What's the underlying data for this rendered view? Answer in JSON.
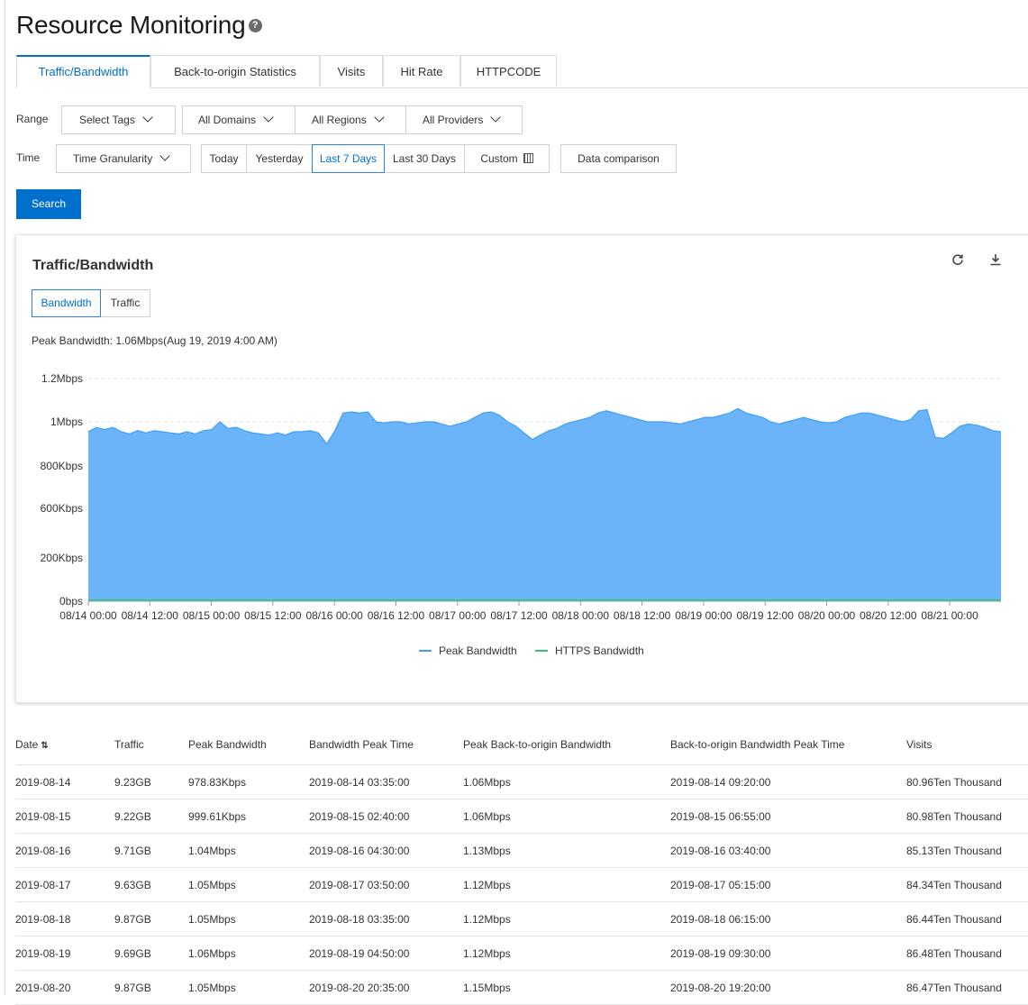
{
  "page": {
    "title": "Resource Monitoring",
    "help_icon": "question-circle-icon"
  },
  "tabs": [
    {
      "label": "Traffic/Bandwidth",
      "active": true
    },
    {
      "label": "Back-to-origin Statistics"
    },
    {
      "label": "Visits"
    },
    {
      "label": "Hit Rate"
    },
    {
      "label": "HTTPCODE"
    }
  ],
  "filters": {
    "range_label": "Range",
    "range_dropdowns": [
      "Select Tags",
      "All Domains",
      "All Regions",
      "All Providers"
    ],
    "time_label": "Time",
    "granularity": "Time Granularity",
    "time_options": [
      "Today",
      "Yesterday",
      "Last 7 Days",
      "Last 30 Days"
    ],
    "selected_time": "Last 7 Days",
    "custom": "Custom",
    "data_comparison": "Data comparison",
    "search": "Search"
  },
  "chart_card": {
    "title": "Traffic/Bandwidth",
    "tools": [
      "refresh-icon",
      "download-icon",
      "collapse-icon"
    ],
    "mini_tabs": [
      "Bandwidth",
      "Traffic"
    ],
    "active_mini_tab": "Bandwidth",
    "peak_text": "Peak Bandwidth: 1.06Mbps(Aug 19, 2019 4:00 AM)"
  },
  "chart_data": {
    "type": "area",
    "y_ticks": [
      "0bps",
      "200Kbps",
      "600Kbps",
      "800Kbps",
      "1Mbps",
      "1.2Mbps"
    ],
    "x_ticks": [
      "08/14 00:00",
      "08/14 12:00",
      "08/15 00:00",
      "08/15 12:00",
      "08/16 00:00",
      "08/16 12:00",
      "08/17 00:00",
      "08/17 12:00",
      "08/18 00:00",
      "08/18 12:00",
      "08/19 00:00",
      "08/19 12:00",
      "08/20 00:00",
      "08/20 12:00",
      "08/21 00:00"
    ],
    "x_hours_range": [
      0,
      178
    ],
    "grid": "horizontal-dashed",
    "legend_position": "bottom-center",
    "series": [
      {
        "name": "Peak Bandwidth",
        "color": "#3d9ff5",
        "fill": "#6cb4fa",
        "unit": "Kbps",
        "values": [
          955,
          975,
          965,
          975,
          955,
          945,
          960,
          950,
          960,
          955,
          950,
          945,
          955,
          945,
          960,
          965,
          1000,
          970,
          975,
          960,
          950,
          945,
          940,
          950,
          940,
          955,
          955,
          960,
          950,
          900,
          960,
          1040,
          1045,
          1040,
          1045,
          1000,
          995,
          1000,
          1000,
          990,
          995,
          1000,
          1000,
          990,
          980,
          990,
          1000,
          1020,
          1040,
          1045,
          1030,
          1000,
          980,
          950,
          920,
          940,
          960,
          970,
          990,
          1000,
          1010,
          1020,
          1040,
          1050,
          1040,
          1030,
          1020,
          1010,
          1000,
          1000,
          1000,
          995,
          990,
          1000,
          1010,
          1020,
          1020,
          1030,
          1040,
          1060,
          1040,
          1030,
          1020,
          1000,
          990,
          1000,
          1010,
          1020,
          1010,
          1000,
          995,
          1000,
          1020,
          1030,
          1040,
          1040,
          1030,
          1020,
          1010,
          1000,
          1010,
          1050,
          1055,
          930,
          925,
          950,
          980,
          990,
          985,
          975,
          960,
          955
        ]
      },
      {
        "name": "HTTPS Bandwidth",
        "color": "#3cc070",
        "unit": "Kbps",
        "values": [
          3,
          3,
          3,
          3,
          3,
          3,
          3,
          3,
          3,
          3,
          3,
          3,
          3,
          3,
          3,
          3,
          3,
          3,
          3,
          3,
          3,
          3,
          3,
          3,
          3,
          3,
          3,
          3,
          3,
          3,
          3,
          3,
          3,
          3,
          3,
          3,
          3,
          3,
          3,
          3,
          3,
          3,
          3,
          3,
          3,
          3,
          3,
          3,
          3,
          3,
          3,
          3,
          3,
          3,
          3,
          3,
          3,
          3,
          3,
          3,
          3,
          3,
          3,
          3,
          3,
          3,
          3,
          3,
          3,
          3,
          3,
          3,
          3,
          3,
          3,
          3,
          3,
          3,
          3,
          3,
          3,
          3,
          3,
          3,
          3,
          3,
          3,
          3,
          3,
          3,
          3,
          3,
          3,
          3,
          3,
          3,
          3,
          3,
          3,
          3,
          3,
          3,
          3,
          3,
          3,
          3,
          3,
          3,
          3,
          3,
          3,
          3
        ]
      }
    ]
  },
  "table": {
    "columns": [
      "Date",
      "Traffic",
      "Peak Bandwidth",
      "Bandwidth Peak Time",
      "Peak Back-to-origin Bandwidth",
      "Back-to-origin Bandwidth Peak Time",
      "Visits"
    ],
    "rows": [
      [
        "2019-08-14",
        "9.23GB",
        "978.83Kbps",
        "2019-08-14 03:35:00",
        "1.06Mbps",
        "2019-08-14 09:20:00",
        "80.96Ten Thousand"
      ],
      [
        "2019-08-15",
        "9.22GB",
        "999.61Kbps",
        "2019-08-15 02:40:00",
        "1.06Mbps",
        "2019-08-15 06:55:00",
        "80.98Ten Thousand"
      ],
      [
        "2019-08-16",
        "9.71GB",
        "1.04Mbps",
        "2019-08-16 04:30:00",
        "1.13Mbps",
        "2019-08-16 03:40:00",
        "85.13Ten Thousand"
      ],
      [
        "2019-08-17",
        "9.63GB",
        "1.05Mbps",
        "2019-08-17 03:50:00",
        "1.12Mbps",
        "2019-08-17 05:15:00",
        "84.34Ten Thousand"
      ],
      [
        "2019-08-18",
        "9.87GB",
        "1.05Mbps",
        "2019-08-18 03:35:00",
        "1.12Mbps",
        "2019-08-18 06:15:00",
        "86.44Ten Thousand"
      ],
      [
        "2019-08-19",
        "9.69GB",
        "1.06Mbps",
        "2019-08-19 04:50:00",
        "1.12Mbps",
        "2019-08-19 09:30:00",
        "86.48Ten Thousand"
      ],
      [
        "2019-08-20",
        "9.87GB",
        "1.05Mbps",
        "2019-08-20 20:35:00",
        "1.15Mbps",
        "2019-08-20 19:20:00",
        "86.47Ten Thousand"
      ]
    ]
  }
}
